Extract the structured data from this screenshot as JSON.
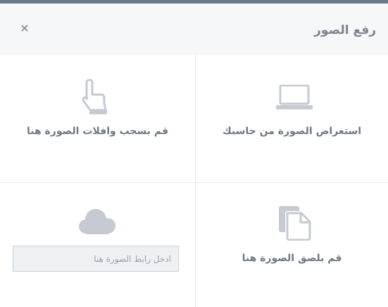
{
  "dialog": {
    "title": "رفع الصور",
    "close_label": "×"
  },
  "options": {
    "browse": {
      "label": "استعراض الصورة من حاسبك",
      "icon": "laptop-icon"
    },
    "drag": {
      "label": "قم بسحب وافلات الصورة هنا",
      "icon": "hand-pointer-icon"
    },
    "paste": {
      "label": "قم بلصق الصورة هنا",
      "icon": "paste-document-icon"
    },
    "url": {
      "placeholder": "ادخل رابط الصورة هنا",
      "icon": "cloud-icon"
    }
  },
  "colors": {
    "top_bar": "#6d7a8a",
    "header_bg": "#f6f7f9",
    "icon_gray": "#c6cad1",
    "text": "#6f7885"
  }
}
